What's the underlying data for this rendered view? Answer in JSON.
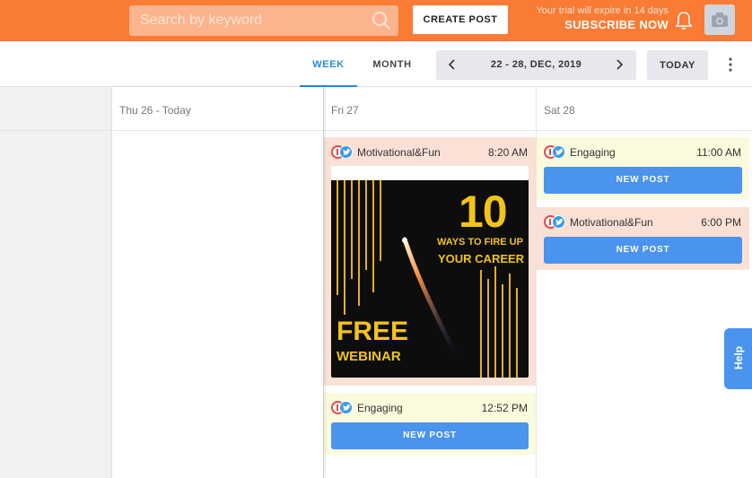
{
  "topbar": {
    "search_placeholder": "Search by keyword",
    "create_post_label": "CREATE POST",
    "trial_message": "Your trial will expire in 14 days",
    "subscribe_label": "SUBSCRIBE NOW"
  },
  "toolbar": {
    "tabs": [
      {
        "label": "WEEK",
        "active": true
      },
      {
        "label": "MONTH",
        "active": false
      }
    ],
    "date_range": "22 - 28, DEC, 2019",
    "today_label": "TODAY"
  },
  "calendar": {
    "days": [
      {
        "label": "Thu 26 - Today",
        "posts": []
      },
      {
        "label": "Fri 27",
        "posts": [
          {
            "title": "Motivational&Fun",
            "time": "8:20 AM",
            "image": {
              "number": "10",
              "line1": "WAYS TO FIRE UP",
              "line2": "YOUR CAREER",
              "line3": "FREE",
              "line4": "WEBINAR"
            }
          },
          {
            "title": "Engaging",
            "time": "12:52 PM",
            "button": "NEW POST"
          }
        ]
      },
      {
        "label": "Sat 28",
        "posts": [
          {
            "title": "Engaging",
            "time": "11:00 AM",
            "button": "NEW POST"
          },
          {
            "title": "Motivational&Fun",
            "time": "6:00 PM",
            "button": "NEW POST"
          }
        ]
      }
    ]
  },
  "help_label": "Help",
  "colors": {
    "brand_orange": "#f97b34",
    "accent_blue": "#4a93ee",
    "post_peach": "#fbe0d5",
    "post_yellow": "#fafadd"
  }
}
